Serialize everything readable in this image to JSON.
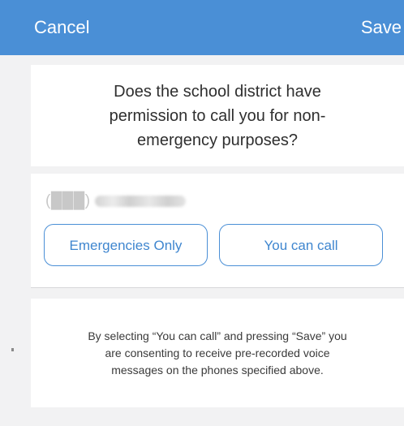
{
  "header": {
    "cancel_label": "Cancel",
    "save_label": "Save",
    "bg_color": "#4a8fd6"
  },
  "question": {
    "text": "Does the school district have permission to call you for non-emergency purposes?"
  },
  "phone": {
    "area_code": "(███)"
  },
  "options": {
    "emergencies_only_label": "Emergencies Only",
    "you_can_call_label": "You can call",
    "accent_color": "#4a8fd6"
  },
  "disclaimer": {
    "text": "By selecting “You can call” and pressing “Save” you are consenting to receive pre-recorded voice messages on the phones specified above."
  }
}
